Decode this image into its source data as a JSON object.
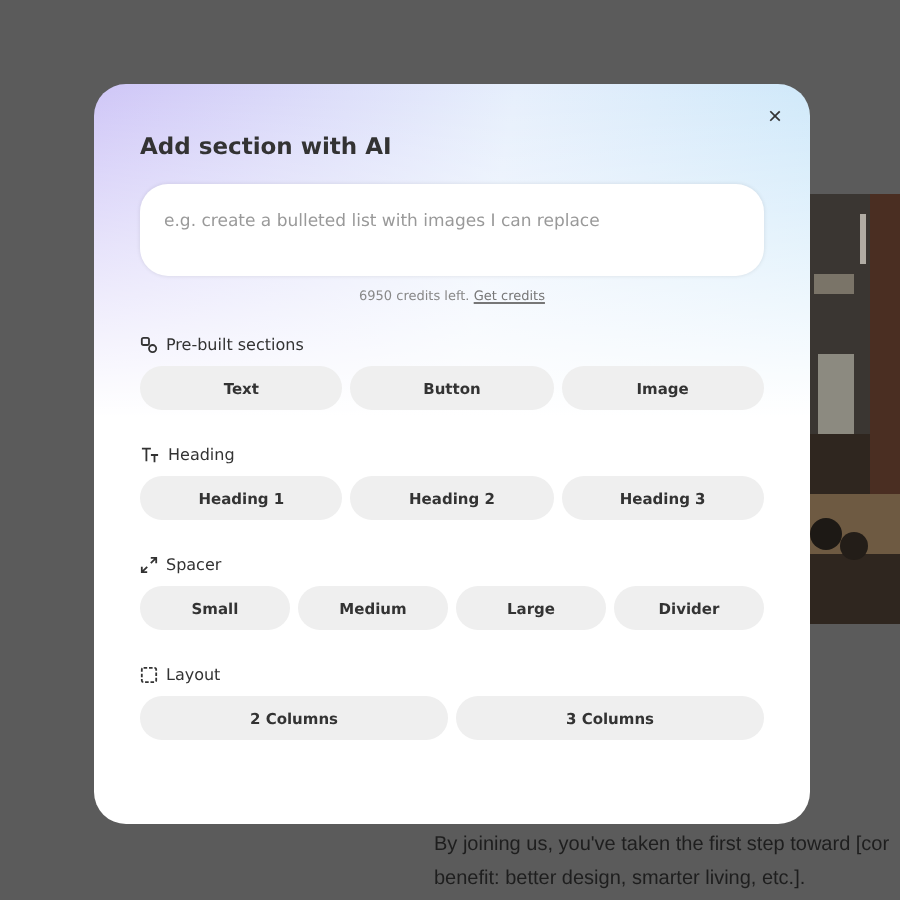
{
  "background_page": {
    "kind": "picture",
    "paragraph_lines": [
      "By joining us, you've taken the first step toward [cor",
      "benefit: better design, smarter living, etc.]."
    ]
  },
  "dialog": {
    "title": "Add section with AI",
    "close": "×",
    "prompt": {
      "placeholder": "e.g. create a bulleted list with images I can replace"
    },
    "credits": {
      "text": "6950 credits left.",
      "link": "Get credits"
    },
    "sections": [
      {
        "kind": "prebuilt",
        "label": "Pre-built sections",
        "options": [
          "Text",
          "Button",
          "Image"
        ]
      },
      {
        "kind": "heading",
        "label": "Heading",
        "options": [
          "Heading 1",
          "Heading 2",
          "Heading 3"
        ]
      },
      {
        "kind": "spacer",
        "label": "Spacer",
        "options": [
          "Small",
          "Medium",
          "Large",
          "Divider"
        ]
      },
      {
        "kind": "layout",
        "label": "Layout",
        "options": [
          "2 Columns",
          "3 Columns"
        ]
      }
    ]
  }
}
